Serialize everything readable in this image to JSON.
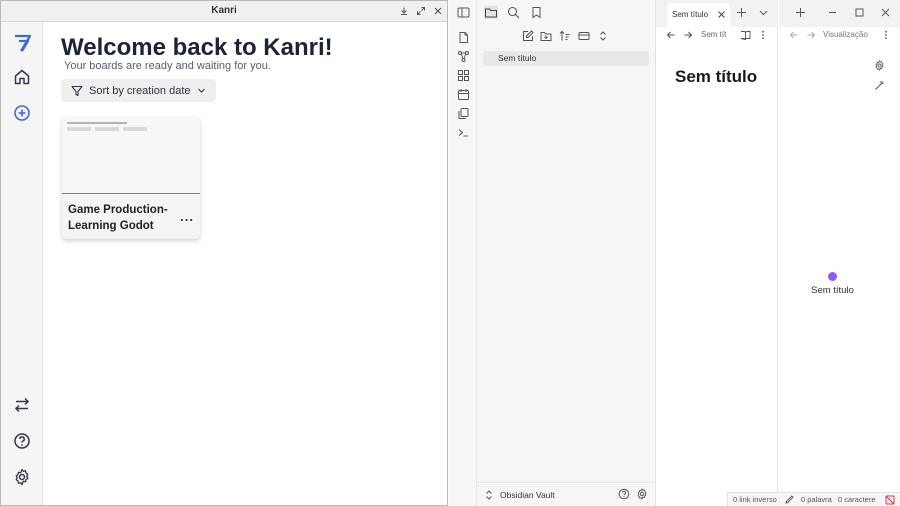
{
  "kanri": {
    "window_title": "Kanri",
    "heading": "Welcome back to Kanri!",
    "subheading": "Your boards are ready and waiting for you.",
    "sort_label": "Sort by creation date",
    "boards": [
      {
        "title": "Game Production- Learning Godot",
        "menu": "..."
      }
    ]
  },
  "obsidian": {
    "file_items": [
      "Sem título"
    ],
    "vault_name": "Obsidian Vault",
    "tab1_label": "Sem título",
    "tab1_breadcrumb": "Sem título",
    "note_title": "Sem título",
    "tab2_breadcrumb": "Visualização",
    "graph_node_label": "Sem título",
    "status": {
      "backlinks": "0 link inverso",
      "words": "0 palavra",
      "chars": "0 caractere"
    }
  },
  "colors": {
    "kanri_accent": "#3f68d8",
    "graph_node": "#8a5cf5",
    "card_border": "#5b7fd4",
    "sync_off": "#e0344a"
  }
}
